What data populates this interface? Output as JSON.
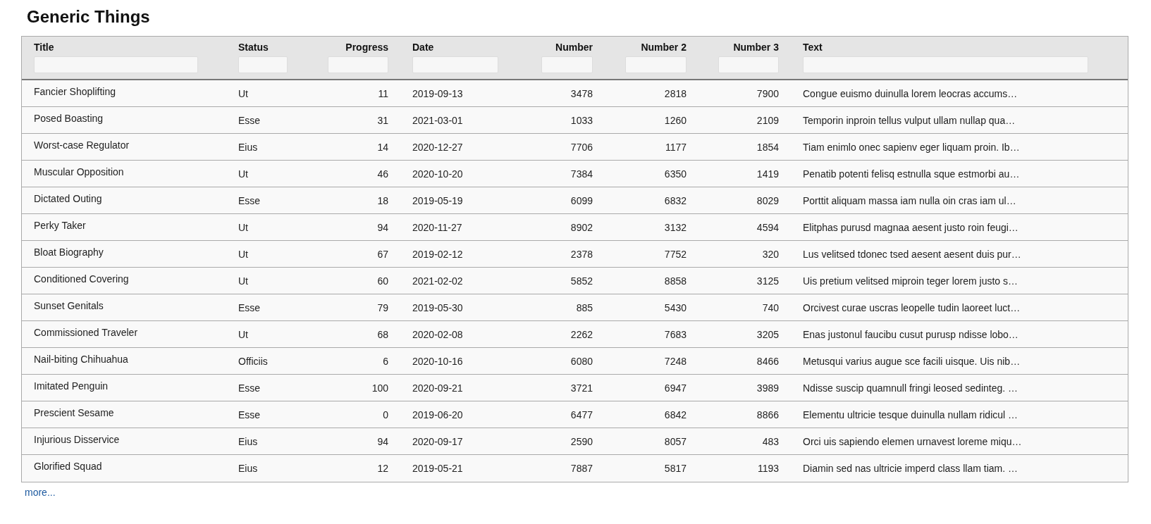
{
  "title": "Generic Things",
  "table": {
    "columns": [
      "Title",
      "Status",
      "Progress",
      "Date",
      "Number",
      "Number 2",
      "Number 3",
      "Text"
    ],
    "rows": [
      [
        "Fancier Shoplifting",
        "Ut",
        "11",
        "2019-09-13",
        "3478",
        "2818",
        "7900",
        "Congue euismo duinulla lorem leocras accums…"
      ],
      [
        "Posed Boasting",
        "Esse",
        "31",
        "2021-03-01",
        "1033",
        "1260",
        "2109",
        "Temporin inproin tellus vulput ullam nullap qua…"
      ],
      [
        "Worst-case Regulator",
        "Eius",
        "14",
        "2020-12-27",
        "7706",
        "1177",
        "1854",
        "Tiam enimlo onec sapienv eger liquam proin. Ib…"
      ],
      [
        "Muscular Opposition",
        "Ut",
        "46",
        "2020-10-20",
        "7384",
        "6350",
        "1419",
        "Penatib potenti felisq estnulla sque estmorbi au…"
      ],
      [
        "Dictated Outing",
        "Esse",
        "18",
        "2019-05-19",
        "6099",
        "6832",
        "8029",
        "Porttit aliquam massa iam nulla oin cras iam ul…"
      ],
      [
        "Perky Taker",
        "Ut",
        "94",
        "2020-11-27",
        "8902",
        "3132",
        "4594",
        "Elitphas purusd magnaa aesent justo roin feugi…"
      ],
      [
        "Bloat Biography",
        "Ut",
        "67",
        "2019-02-12",
        "2378",
        "7752",
        "320",
        "Lus velitsed tdonec tsed aesent aesent duis pur…"
      ],
      [
        "Conditioned Covering",
        "Ut",
        "60",
        "2021-02-02",
        "5852",
        "8858",
        "3125",
        "Uis pretium velitsed miproin teger lorem justo s…"
      ],
      [
        "Sunset Genitals",
        "Esse",
        "79",
        "2019-05-30",
        "885",
        "5430",
        "740",
        "Orcivest curae uscras leopelle tudin laoreet luct…"
      ],
      [
        "Commissioned Traveler",
        "Ut",
        "68",
        "2020-02-08",
        "2262",
        "7683",
        "3205",
        "Enas justonul faucibu cusut purusp ndisse lobo…"
      ],
      [
        "Nail-biting Chihuahua",
        "Officiis",
        "6",
        "2020-10-16",
        "6080",
        "7248",
        "8466",
        "Metusqui varius augue sce facili uisque. Uis nib…"
      ],
      [
        "Imitated Penguin",
        "Esse",
        "100",
        "2020-09-21",
        "3721",
        "6947",
        "3989",
        "Ndisse suscip quamnull fringi leosed sedinteg. …"
      ],
      [
        "Prescient Sesame",
        "Esse",
        "0",
        "2019-06-20",
        "6477",
        "6842",
        "8866",
        "Elementu ultricie tesque duinulla nullam ridicul …"
      ],
      [
        "Injurious Disservice",
        "Eius",
        "94",
        "2020-09-17",
        "2590",
        "8057",
        "483",
        "Orci uis sapiendo elemen urnavest loreme miqu…"
      ],
      [
        "Glorified Squad",
        "Eius",
        "12",
        "2019-05-21",
        "7887",
        "5817",
        "1193",
        "Diamin sed nas ultricie imperd class llam tiam. …"
      ]
    ]
  },
  "more_link": "more..."
}
